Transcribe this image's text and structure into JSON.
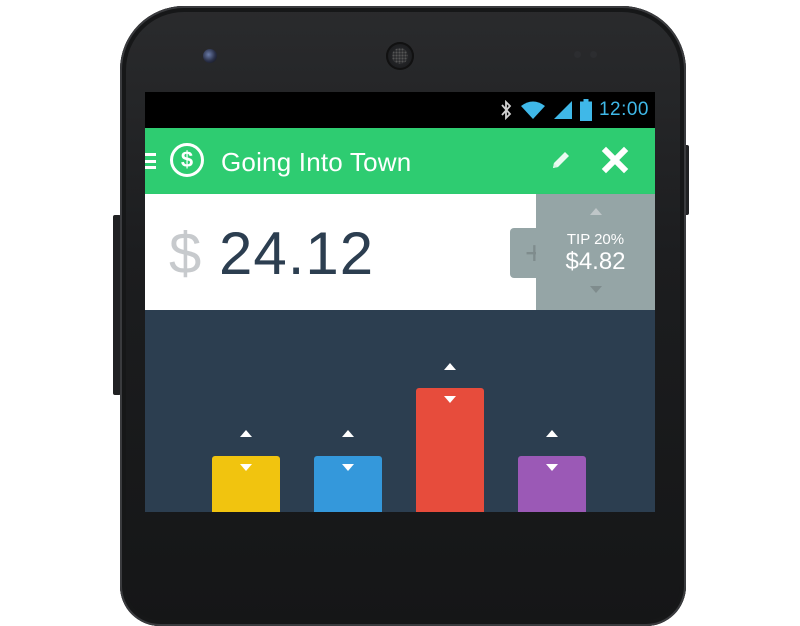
{
  "statusbar": {
    "time": "12:00",
    "icons": [
      "bluetooth-icon",
      "wifi-icon",
      "signal-icon",
      "battery-icon"
    ],
    "accent": "#3fb8e8"
  },
  "appbar": {
    "title": "Going Into Town",
    "currency_icon": "$",
    "color": "#2ecc71",
    "icons": [
      "menu-icon",
      "dollar-circle-icon",
      "pencil-icon",
      "close-icon"
    ]
  },
  "amount": {
    "currency_symbol": "$",
    "value": "24.12"
  },
  "tip": {
    "add_symbol": "+",
    "label": "TIP 20%",
    "amount": "$4.82",
    "panel_color": "#95a5a6"
  },
  "split": {
    "background": "#2c3e50",
    "bars": [
      {
        "color": "#f1c40f",
        "level": "low"
      },
      {
        "color": "#3498db",
        "level": "low"
      },
      {
        "color": "#e74c3c",
        "level": "high"
      },
      {
        "color": "#9b59b6",
        "level": "low"
      }
    ]
  }
}
